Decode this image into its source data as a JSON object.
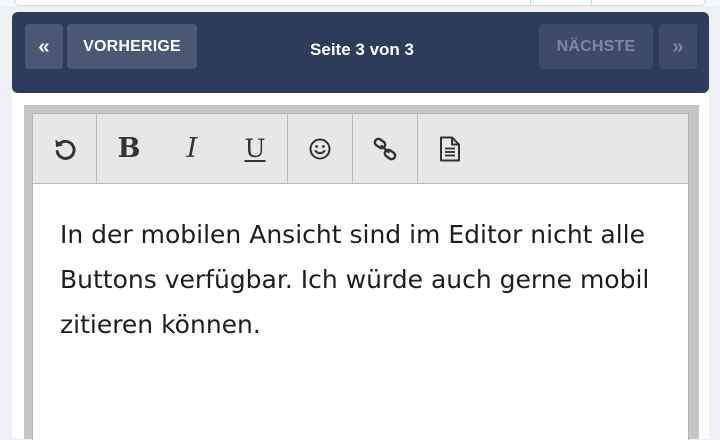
{
  "pagination": {
    "first_label": "«",
    "prev_label": "VORHERIGE",
    "page_info": "Seite 3 von 3",
    "next_label": "NÄCHSTE",
    "last_label": "»"
  },
  "toolbar": {
    "buttons": [
      {
        "name": "undo",
        "icon": "undo-icon"
      },
      {
        "name": "bold",
        "glyph": "B"
      },
      {
        "name": "italic",
        "glyph": "I"
      },
      {
        "name": "underline",
        "glyph": "U"
      },
      {
        "name": "emoji",
        "icon": "smiley-icon"
      },
      {
        "name": "link",
        "icon": "link-icon"
      },
      {
        "name": "source",
        "icon": "document-icon"
      }
    ]
  },
  "editor": {
    "text": "In der mobilen Ansicht sind im Editor nicht alle Buttons verfügbar. Ich würde auch gerne mobil zitieren können."
  },
  "colors": {
    "pagination_bg": "#2d3c5b",
    "button_active": "#4a5874",
    "button_disabled": "#3e4b67",
    "toolbar_bg": "#e7e7e7"
  }
}
